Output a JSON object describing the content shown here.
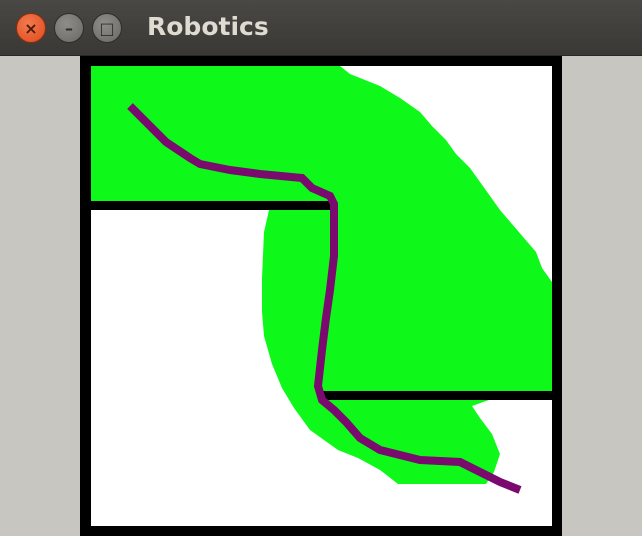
{
  "window": {
    "title": "Robotics",
    "close_icon": "close-icon",
    "minimize_icon": "minimize-icon",
    "maximize_icon": "maximize-icon"
  },
  "scene": {
    "colors": {
      "free_space": "#ffffff",
      "explored": "#0ef91a",
      "obstacle": "#000000",
      "path": "#7a0a6e",
      "background": "#c8c6c0"
    }
  }
}
